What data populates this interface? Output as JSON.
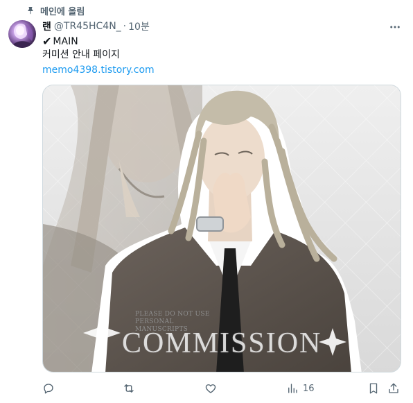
{
  "pinned": {
    "label": "메인에 올림"
  },
  "post": {
    "display_name": "랜",
    "handle": "@TR45HC4N_",
    "separator": "·",
    "time": "10분",
    "check_symbol": "✔",
    "line1": "MAIN",
    "line2": "커미션 안내 페이지",
    "link": "memo4398.tistory.com"
  },
  "media": {
    "notice_line1": "PLEASE DO NOT USE",
    "notice_line2": "PERSONAL MANUSCRIPTS",
    "watermark": "COMMISSION"
  },
  "actions": {
    "views_count": "16"
  },
  "colors": {
    "accent": "#1d9bf0",
    "secondary_text": "#536471",
    "primary_text": "#0f1419",
    "border": "#cfd9de"
  },
  "icons": [
    "pin-icon",
    "more-icon",
    "reply-icon",
    "retweet-icon",
    "like-icon",
    "views-icon",
    "bookmark-icon",
    "share-icon"
  ]
}
